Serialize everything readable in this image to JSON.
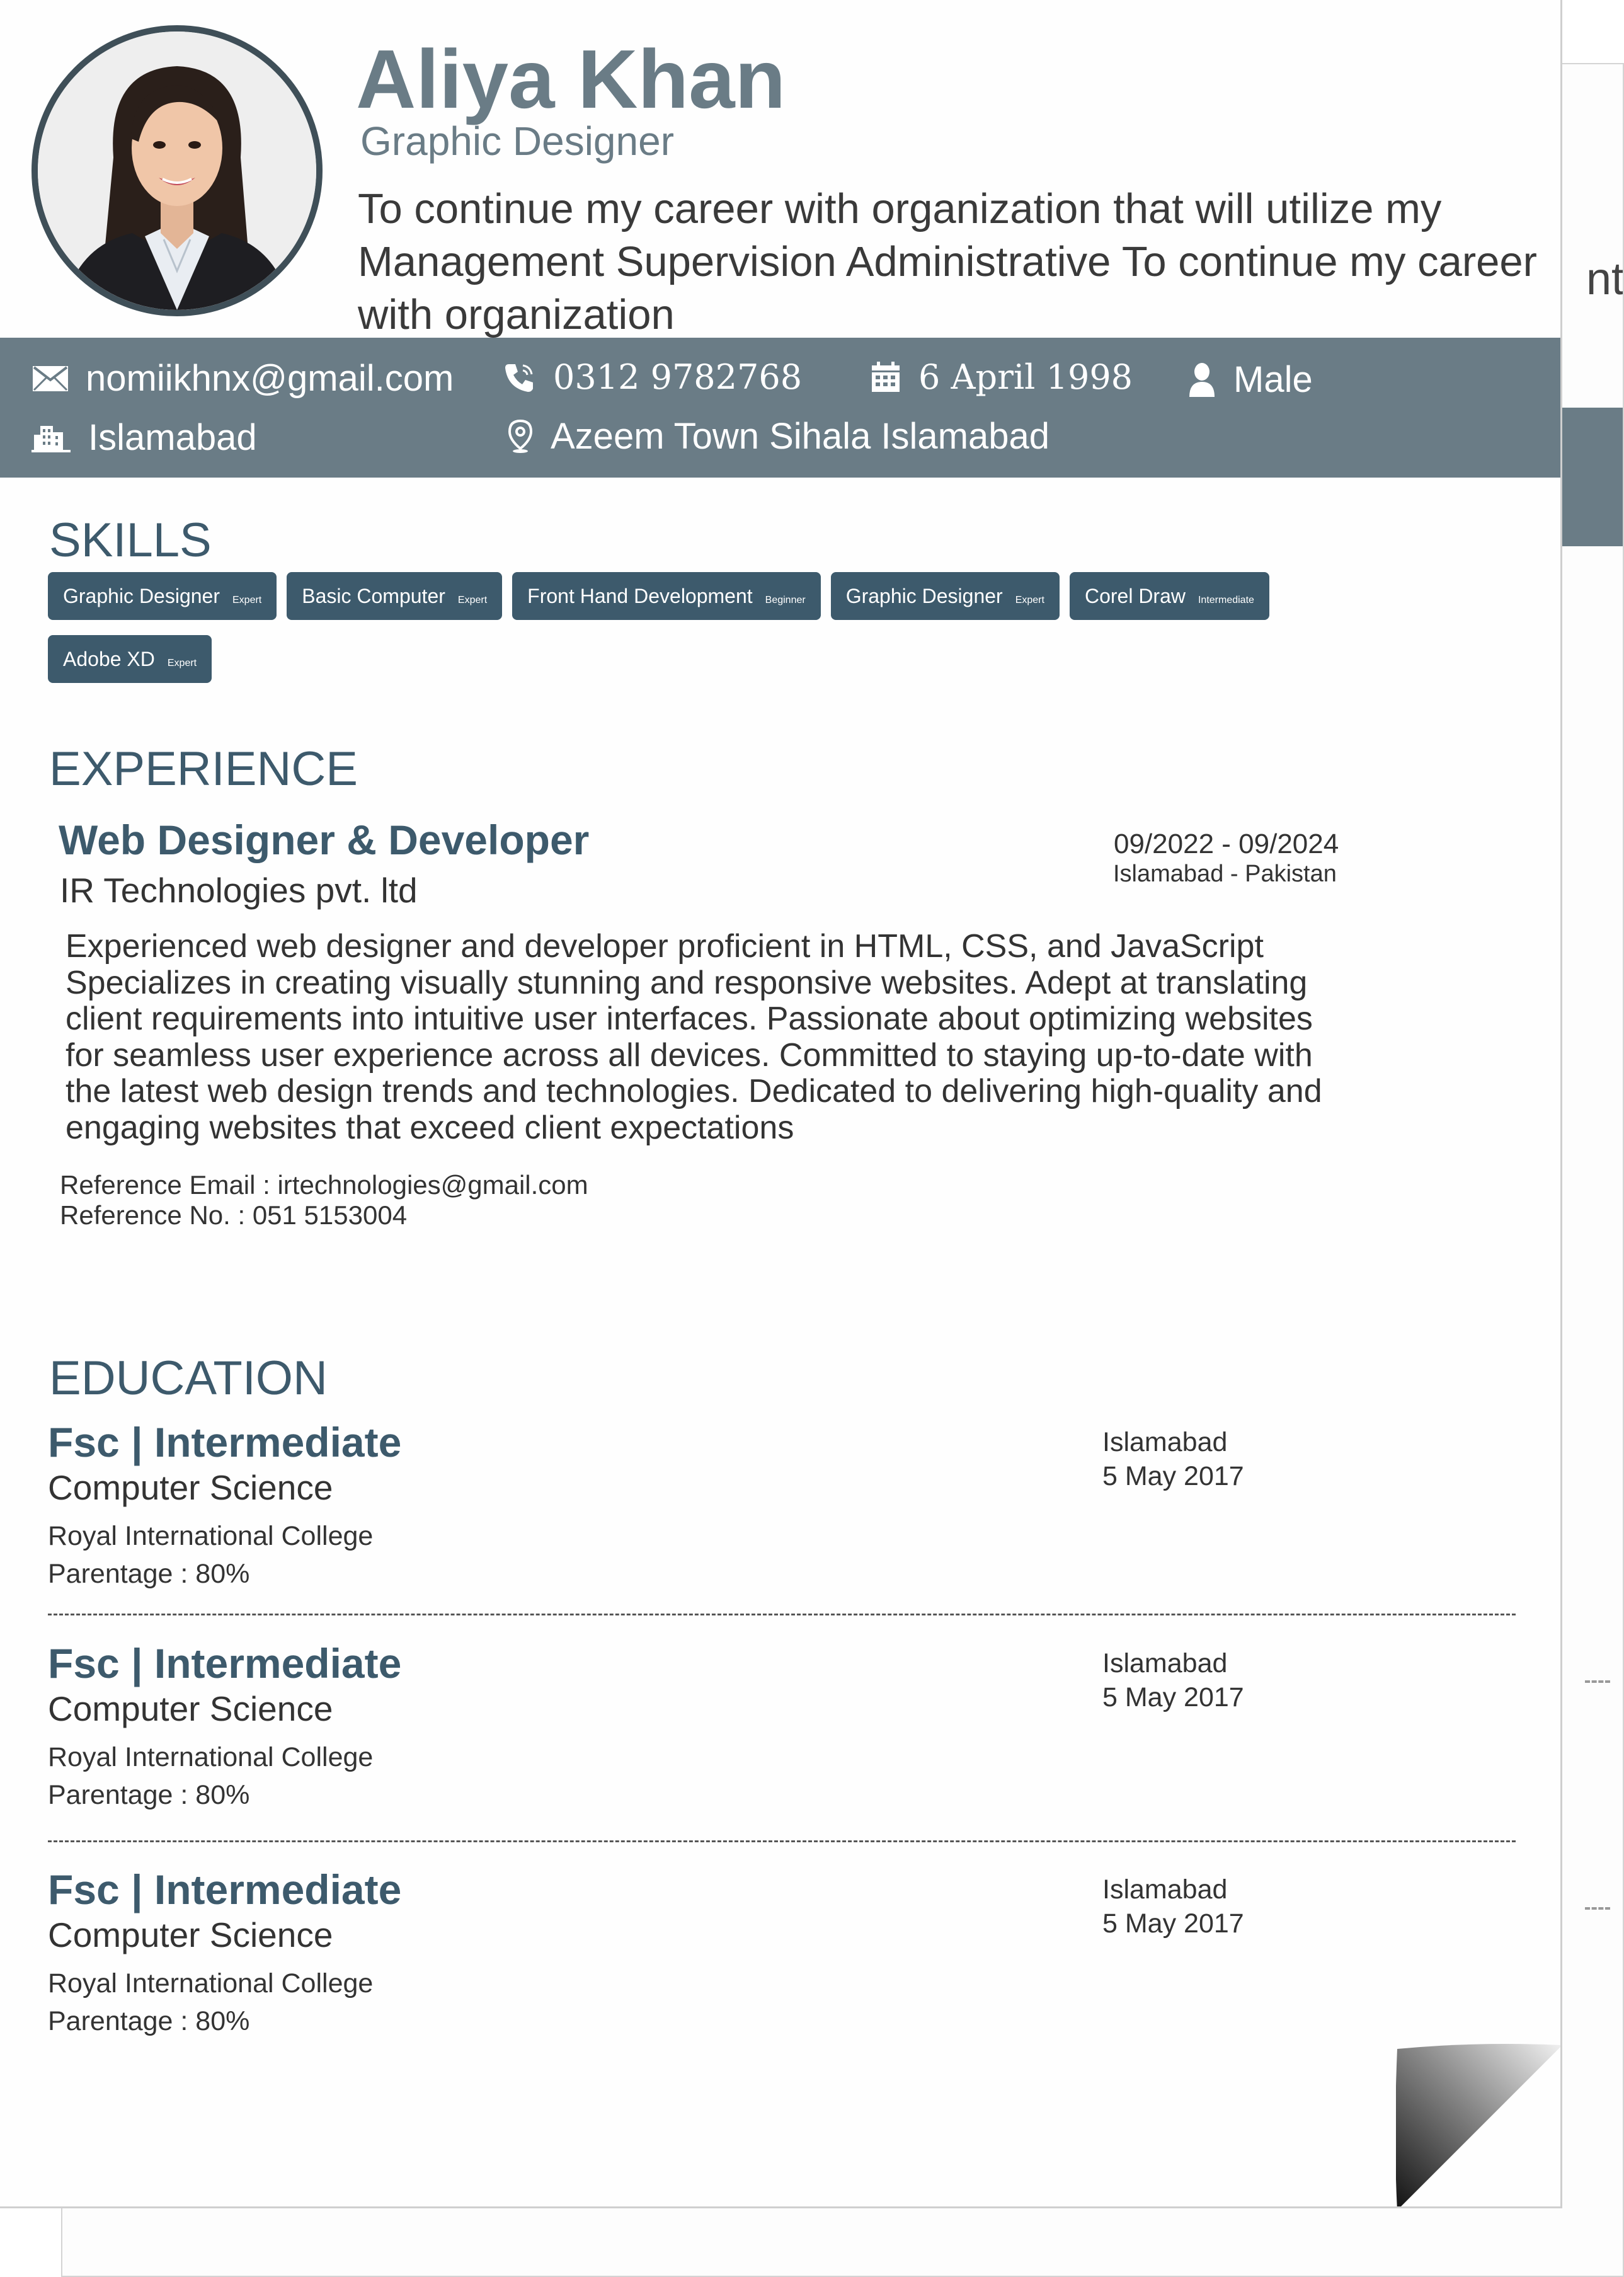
{
  "profile": {
    "name": "Aliya Khan",
    "title": "Graphic Designer",
    "objective": "To continue my career with organization that will utilize my Management Supervision Administrative To continue my career with organization"
  },
  "contact": {
    "email": "nomiikhnx@gmail.com",
    "phone": "0312 9782768",
    "dob": "6 April 1998",
    "gender": "Male",
    "city": "Islamabad",
    "address": "Azeem Town Sihala Islamabad"
  },
  "skills": {
    "heading": "SKILLS",
    "items": [
      {
        "name": "Graphic Designer",
        "level": "Expert"
      },
      {
        "name": "Basic Computer",
        "level": "Expert"
      },
      {
        "name": "Front Hand Development",
        "level": "Beginner"
      },
      {
        "name": "Graphic Designer",
        "level": "Expert"
      },
      {
        "name": "Corel Draw",
        "level": "Intermediate"
      },
      {
        "name": "Adobe XD",
        "level": "Expert"
      }
    ]
  },
  "experience": {
    "heading": "EXPERIENCE",
    "role": "Web Designer & Developer",
    "company": "IR Technologies pvt. ltd",
    "dates": "09/2022 - 09/2024",
    "location": "Islamabad - Pakistan",
    "description": "Experienced web designer and developer proficient in  HTML, CSS, and JavaScript\nSpecializes in creating  visually stunning and responsive websites. Adept at translating\nclient requirements into intuitive user interfaces. Passionate about optimizing websites\nfor seamless user experience across all devices. Committed to staying up-to-date with\nthe latest web design trends and technologies. Dedicated to delivering high-quality and\nengaging websites that exceed client expectations",
    "reference_email": "Reference Email : irtechnologies@gmail.com",
    "reference_no": "Reference No. : 051 5153004"
  },
  "education": {
    "heading": "EDUCATION",
    "entries": [
      {
        "degree": "Fsc | Intermediate",
        "field": "Computer Science",
        "school": "Royal International College",
        "grade": "Parentage : 80%",
        "city": "Islamabad",
        "date": "5 May 2017"
      },
      {
        "degree": "Fsc | Intermediate",
        "field": "Computer Science",
        "school": "Royal International College",
        "grade": "Parentage : 80%",
        "city": "Islamabad",
        "date": "5 May 2017"
      },
      {
        "degree": "Fsc | Intermediate",
        "field": "Computer Science",
        "school": "Royal International College",
        "grade": "Parentage : 80%",
        "city": "Islamabad",
        "date": "5 May 2017"
      }
    ]
  },
  "back_page": {
    "partial_text": "nt"
  },
  "colors": {
    "band": "#6a7c86",
    "accent": "#3d5a6c",
    "text": "#333333",
    "avatar_ring": "#3f4f58"
  },
  "icons": [
    "envelope-icon",
    "phone-icon",
    "calendar-icon",
    "user-icon",
    "building-icon",
    "location-pin-icon"
  ]
}
